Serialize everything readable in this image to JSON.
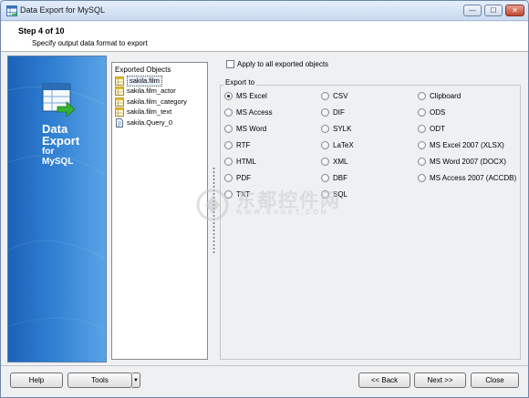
{
  "window": {
    "title": "Data Export for MySQL",
    "controls": {
      "minimize": "—",
      "maximize": "☐",
      "close": "✕"
    }
  },
  "header": {
    "step": "Step 4 of 10",
    "subtitle": "Specify output data format to export"
  },
  "sidebar": {
    "product_lines": [
      "Data",
      "Export",
      "for",
      "MySQL"
    ],
    "icon": "data-export-icon"
  },
  "objects": {
    "title": "Exported Objects",
    "items": [
      {
        "label": "sakila.film",
        "selected": true
      },
      {
        "label": "sakila.film_actor",
        "selected": false
      },
      {
        "label": "sakila.film_category",
        "selected": false
      },
      {
        "label": "sakila.film_text",
        "selected": false
      },
      {
        "label": "sakila.Query_0",
        "selected": false
      }
    ]
  },
  "apply_all": {
    "label": "Apply to all exported objects",
    "checked": false
  },
  "export_to": {
    "label": "Export to",
    "selected": "MS Excel",
    "formats": [
      [
        "MS Excel",
        "CSV",
        "Clipboard"
      ],
      [
        "MS Access",
        "DIF",
        "ODS"
      ],
      [
        "MS Word",
        "SYLK",
        "ODT"
      ],
      [
        "RTF",
        "LaTeX",
        "MS Excel 2007 (XLSX)"
      ],
      [
        "HTML",
        "XML",
        "MS Word 2007 (DOCX)"
      ],
      [
        "PDF",
        "DBF",
        "MS Access 2007 (ACCDB)"
      ],
      [
        "TXT",
        "SQL",
        ""
      ]
    ]
  },
  "watermark": {
    "title": "东都控件网",
    "sub": "WWW.EVGET.COM"
  },
  "buttons": {
    "help": "Help",
    "tools": "Tools",
    "tools_arrow": "▼",
    "back": "<< Back",
    "next": "Next >>",
    "close": "Close"
  },
  "colors": {
    "sidebar_dark": "#1d62b8",
    "sidebar_light": "#5aa3e6",
    "dialog_bg": "#eef0f2"
  }
}
